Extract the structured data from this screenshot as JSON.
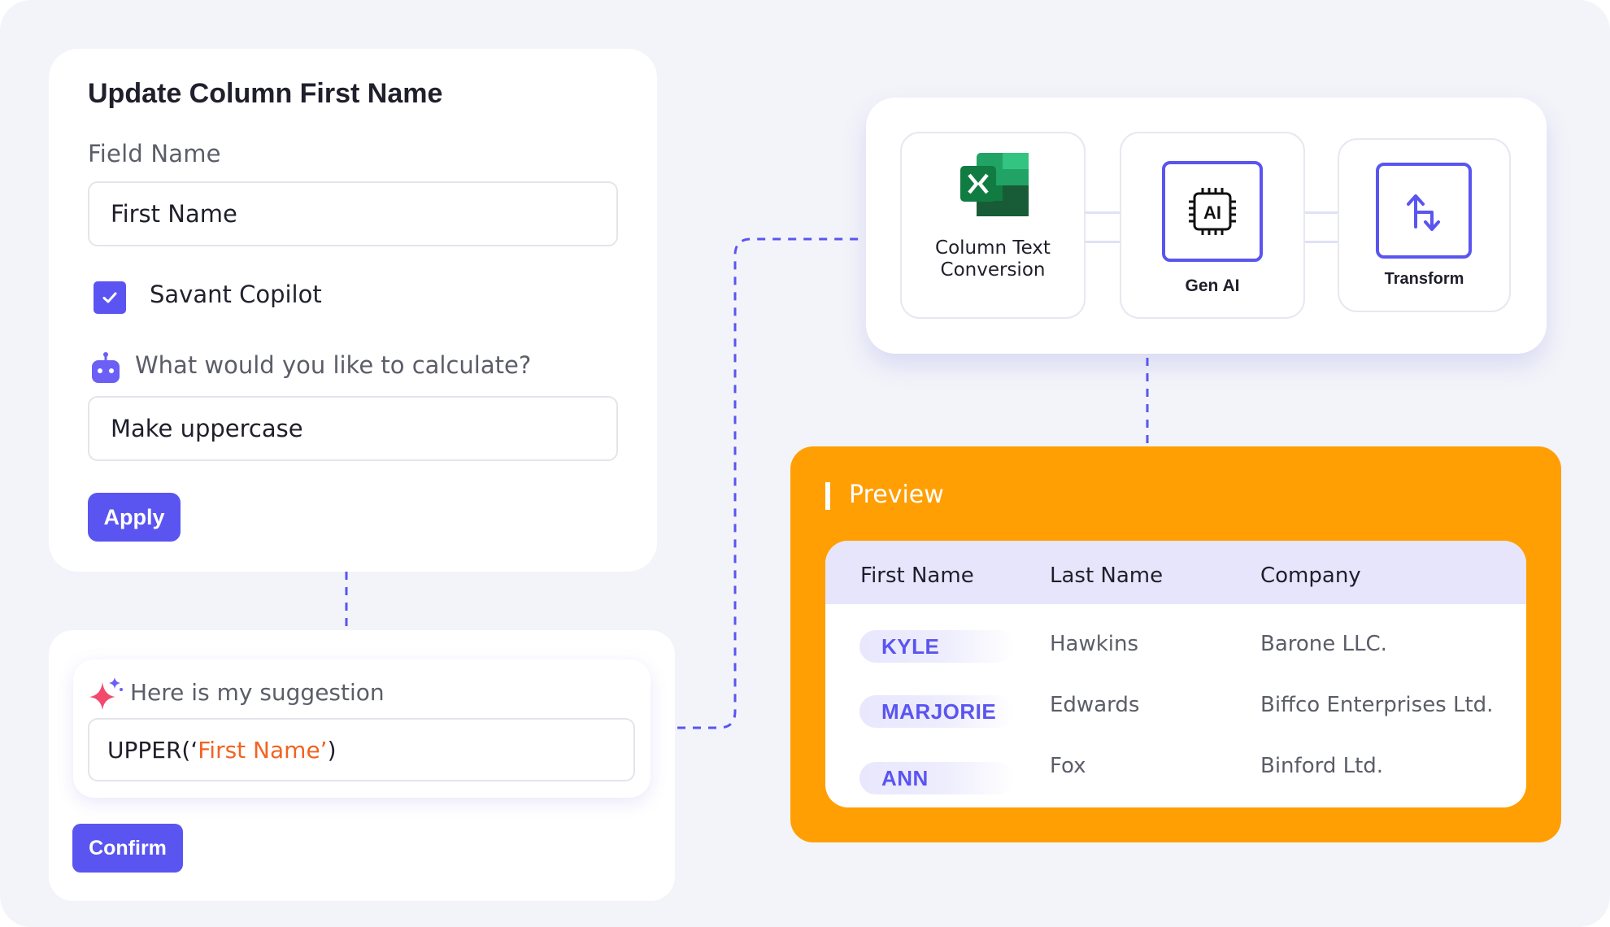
{
  "update_card": {
    "title": "Update Column First Name",
    "field_name_label": "Field Name",
    "field_name_value": "First Name",
    "copilot_label": "Savant Copilot",
    "copilot_checked": true,
    "calc_prompt": "What would you like to calculate?",
    "calc_value": "Make uppercase",
    "apply_label": "Apply"
  },
  "suggestion": {
    "label": "Here is my suggestion",
    "formula_prefix": "UPPER(‘",
    "formula_arg": "First Name’",
    "formula_suffix": ")",
    "confirm_label": "Confirm"
  },
  "pipeline": {
    "steps": [
      {
        "label": "Column Text\nConversion",
        "icon": "excel-icon"
      },
      {
        "label": "Gen AI",
        "icon": "ai-chip-icon"
      },
      {
        "label": "Transform",
        "icon": "transform-arrows-icon"
      }
    ]
  },
  "preview": {
    "title": "Preview",
    "columns": [
      "First Name",
      "Last Name",
      "Company"
    ],
    "rows": [
      {
        "first": "KYLE",
        "last": "Hawkins",
        "company": "Barone LLC."
      },
      {
        "first": "MARJORIE",
        "last": "Edwards",
        "company": "Biffco Enterprises Ltd."
      },
      {
        "first": "ANN",
        "last": "Fox",
        "company": "Binford Ltd."
      }
    ]
  },
  "colors": {
    "accent": "#5a55f0",
    "preview_bg": "#ff9f04",
    "formula_arg": "#f26322",
    "background": "#f3f4f9"
  }
}
